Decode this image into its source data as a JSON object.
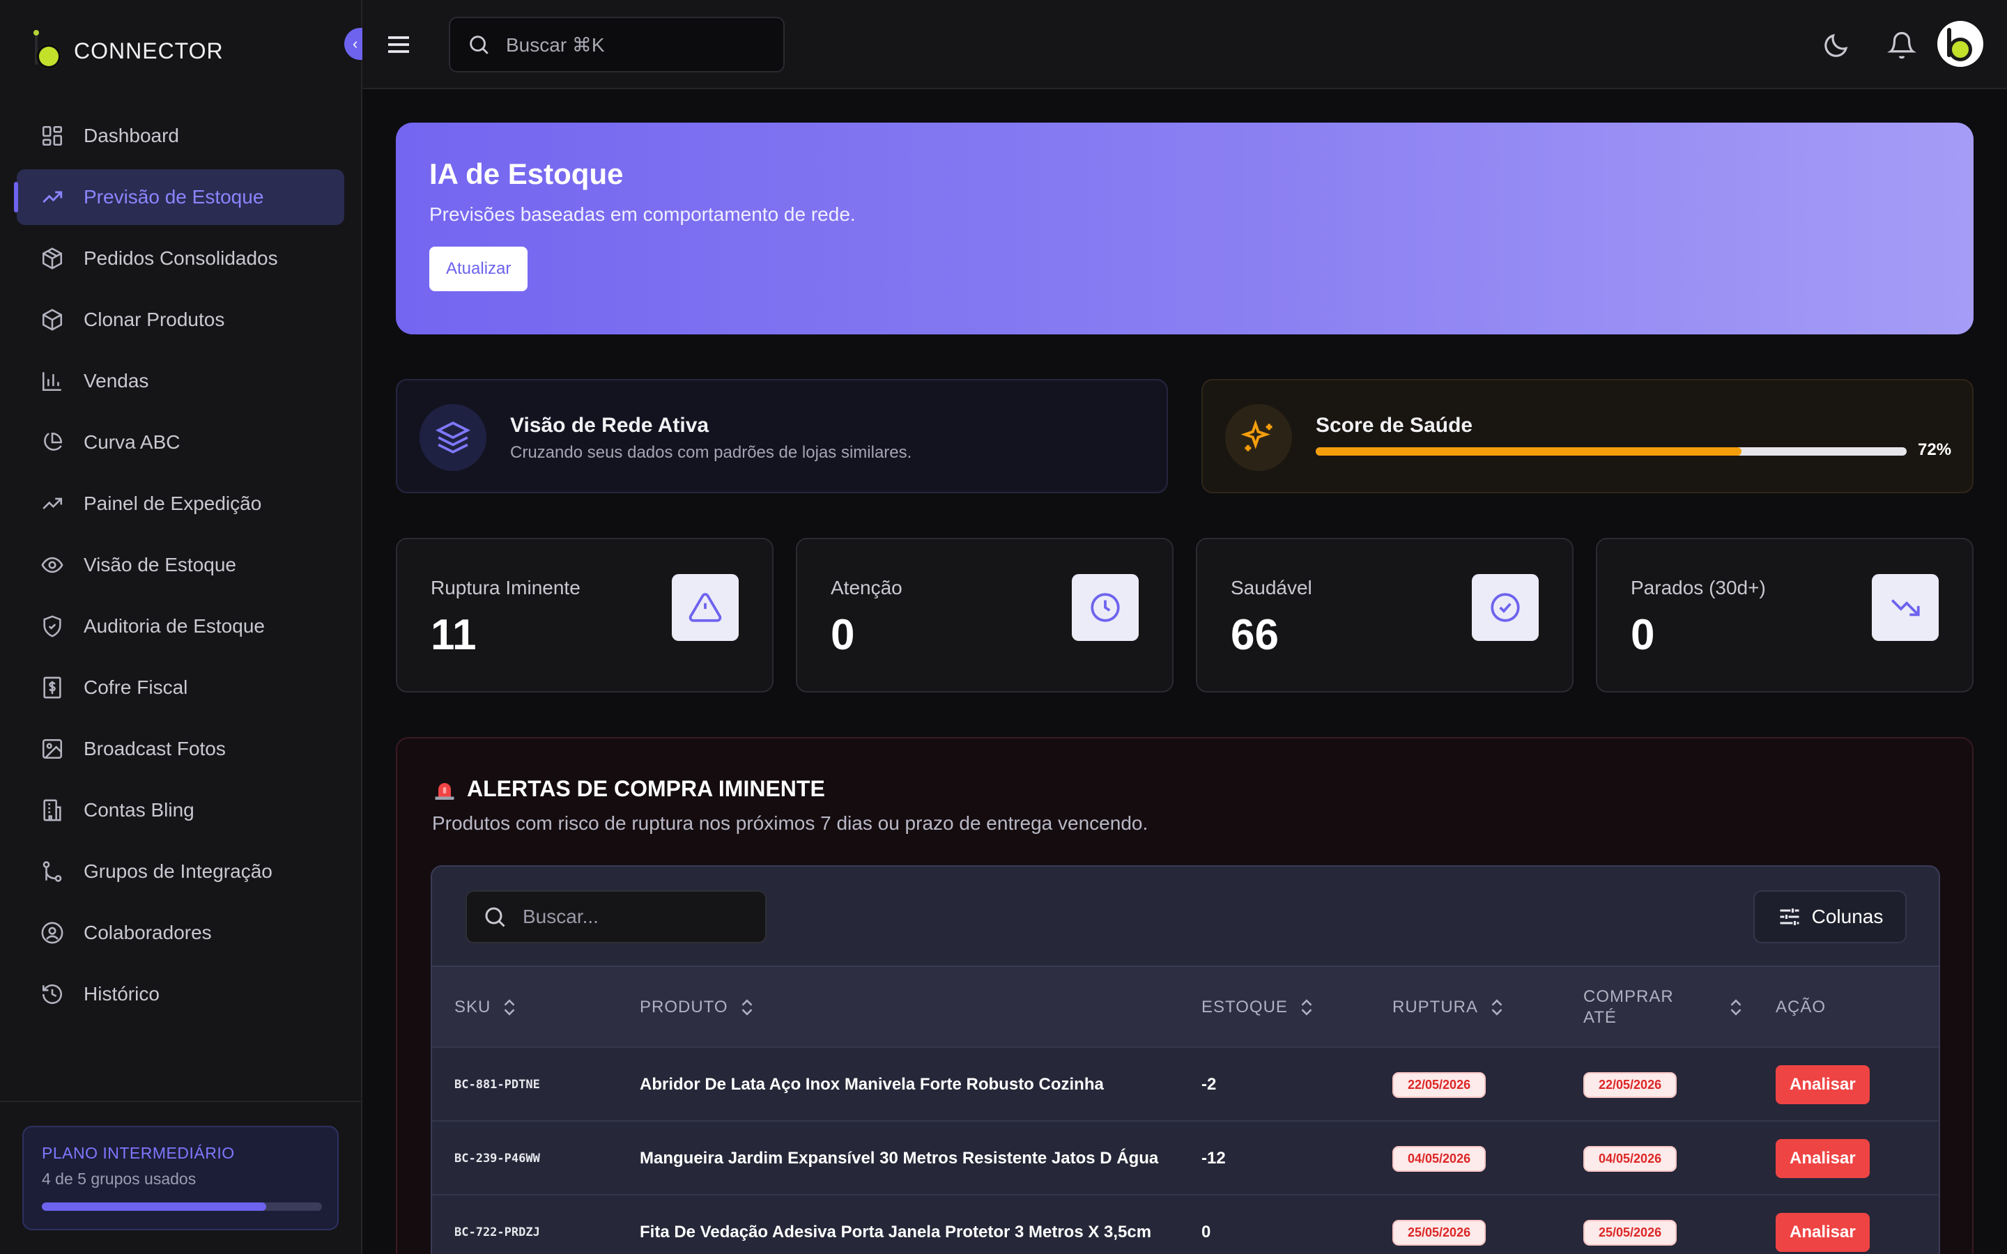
{
  "app": {
    "brand": "CONNECTOR"
  },
  "sidebar": {
    "items": [
      {
        "label": "Dashboard",
        "icon": "dashboard-icon"
      },
      {
        "label": "Previsão de Estoque",
        "icon": "trending-up-icon",
        "active": true
      },
      {
        "label": "Pedidos Consolidados",
        "icon": "package-icon"
      },
      {
        "label": "Clonar Produtos",
        "icon": "box-icon"
      },
      {
        "label": "Vendas",
        "icon": "bar-chart-icon"
      },
      {
        "label": "Curva ABC",
        "icon": "pie-chart-icon"
      },
      {
        "label": "Painel de Expedição",
        "icon": "trending-up-icon"
      },
      {
        "label": "Visão de Estoque",
        "icon": "eye-icon"
      },
      {
        "label": "Auditoria de Estoque",
        "icon": "shield-check-icon"
      },
      {
        "label": "Cofre Fiscal",
        "icon": "receipt-icon"
      },
      {
        "label": "Broadcast Fotos",
        "icon": "image-icon"
      },
      {
        "label": "Contas Bling",
        "icon": "building-icon"
      },
      {
        "label": "Grupos de Integração",
        "icon": "git-branch-icon"
      },
      {
        "label": "Colaboradores",
        "icon": "user-circle-icon"
      },
      {
        "label": "Histórico",
        "icon": "history-icon"
      }
    ],
    "plan": {
      "title": "PLANO INTERMEDIÁRIO",
      "usage": "4 de 5 grupos usados",
      "progress": 0.8
    }
  },
  "header": {
    "search_placeholder": "Buscar ⌘K"
  },
  "hero": {
    "title": "IA de Estoque",
    "subtitle": "Previsões baseadas em comportamento de rede.",
    "button": "Atualizar"
  },
  "network": {
    "title": "Visão de Rede Ativa",
    "subtitle": "Cruzando seus dados com padrões de lojas similares."
  },
  "health": {
    "title": "Score de Saúde",
    "percent_label": "72%",
    "value": 72
  },
  "stats": [
    {
      "label": "Ruptura Iminente",
      "value": "11",
      "icon": "alert-triangle-icon"
    },
    {
      "label": "Atenção",
      "value": "0",
      "icon": "clock-icon"
    },
    {
      "label": "Saudável",
      "value": "66",
      "icon": "check-circle-icon"
    },
    {
      "label": "Parados (30d+)",
      "value": "0",
      "icon": "trending-down-icon"
    }
  ],
  "alerts": {
    "title": "ALERTAS DE COMPRA IMINENTE",
    "subtitle": "Produtos com risco de ruptura nos próximos 7 dias ou prazo de entrega vencendo.",
    "search_placeholder": "Buscar...",
    "columns_button": "Colunas",
    "columns": [
      "SKU",
      "PRODUTO",
      "ESTOQUE",
      "RUPTURA",
      "COMPRAR ATÉ",
      "AÇÃO"
    ],
    "rows": [
      {
        "sku": "BC-881-PDTNE",
        "product": "Abridor De Lata Aço Inox Manivela Forte Robusto Cozinha",
        "stock": "-2",
        "rupture": "22/05/2026",
        "buy_by": "22/05/2026",
        "action": "Analisar"
      },
      {
        "sku": "BC-239-P46WW",
        "product": "Mangueira Jardim Expansível 30 Metros Resistente Jatos D Água",
        "stock": "-12",
        "rupture": "04/05/2026",
        "buy_by": "04/05/2026",
        "action": "Analisar"
      },
      {
        "sku": "BC-722-PRDZJ",
        "product": "Fita De Vedação Adesiva Porta Janela Protetor 3 Metros X 3,5cm",
        "stock": "0",
        "rupture": "25/05/2026",
        "buy_by": "25/05/2026",
        "action": "Analisar"
      }
    ]
  },
  "colors": {
    "accent": "#6d63ee",
    "danger": "#ef4444",
    "warning": "#f59e0b"
  }
}
